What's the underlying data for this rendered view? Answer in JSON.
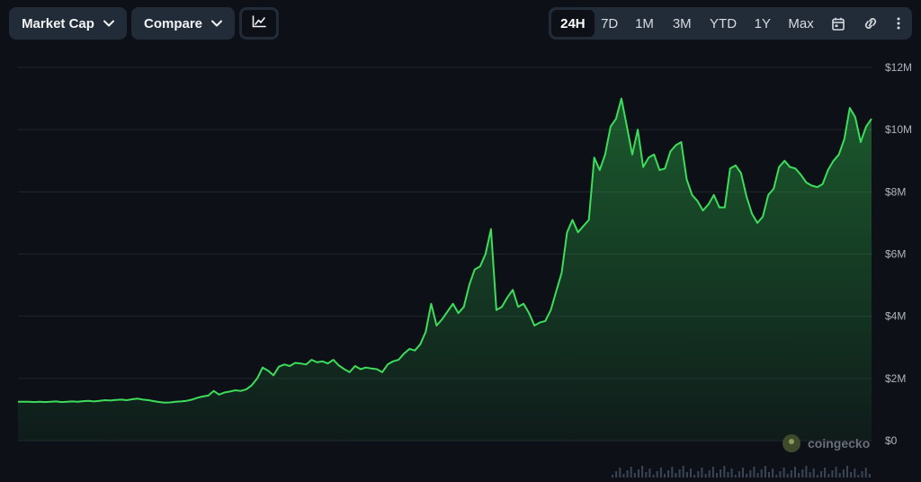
{
  "toolbar": {
    "market_cap_label": "Market Cap",
    "compare_label": "Compare",
    "chart_type_icon": "line-chart-icon",
    "ranges": [
      "24H",
      "7D",
      "1M",
      "3M",
      "YTD",
      "1Y",
      "Max"
    ],
    "active_range": "24H",
    "calendar_icon": "calendar-icon",
    "link_icon": "link-icon",
    "more_icon": "more-vertical-icon"
  },
  "watermark": {
    "text": "coingecko",
    "icon": "coingecko-logo-icon"
  },
  "colors": {
    "background": "#0d1117",
    "line": "#3ddc5a",
    "grid": "#1f252d",
    "control": "#222b38"
  },
  "chart_data": {
    "type": "area",
    "title": "",
    "xlabel": "",
    "ylabel": "",
    "y_tick_labels": [
      "$12M",
      "$10M",
      "$8M",
      "$6M",
      "$4M",
      "$2M",
      "$0"
    ],
    "y_ticks": [
      12,
      10,
      8,
      6,
      4,
      2,
      0
    ],
    "ylim": [
      0,
      12
    ],
    "unit": "$M",
    "grid": true,
    "series": [
      {
        "values": [
          1.25,
          1.25,
          1.25,
          1.24,
          1.25,
          1.24,
          1.25,
          1.26,
          1.24,
          1.25,
          1.26,
          1.25,
          1.27,
          1.28,
          1.26,
          1.28,
          1.3,
          1.29,
          1.31,
          1.32,
          1.3,
          1.33,
          1.35,
          1.32,
          1.3,
          1.27,
          1.24,
          1.22,
          1.23,
          1.25,
          1.26,
          1.28,
          1.32,
          1.38,
          1.42,
          1.45,
          1.6,
          1.48,
          1.55,
          1.58,
          1.62,
          1.6,
          1.65,
          1.78,
          2.0,
          2.35,
          2.25,
          2.1,
          2.38,
          2.45,
          2.4,
          2.5,
          2.48,
          2.45,
          2.6,
          2.52,
          2.55,
          2.48,
          2.6,
          2.42,
          2.3,
          2.2,
          2.4,
          2.3,
          2.35,
          2.32,
          2.3,
          2.2,
          2.45,
          2.55,
          2.6,
          2.8,
          2.95,
          2.9,
          3.1,
          3.5,
          4.4,
          3.7,
          3.9,
          4.15,
          4.4,
          4.1,
          4.3,
          5.0,
          5.5,
          5.6,
          6.0,
          6.8,
          4.2,
          4.3,
          4.6,
          4.85,
          4.3,
          4.4,
          4.1,
          3.7,
          3.8,
          3.85,
          4.2,
          4.8,
          5.4,
          6.7,
          7.1,
          6.7,
          6.9,
          7.1,
          9.1,
          8.7,
          9.2,
          10.1,
          10.35,
          11.0,
          10.1,
          9.2,
          10.0,
          8.8,
          9.1,
          9.2,
          8.7,
          8.75,
          9.3,
          9.5,
          9.6,
          8.4,
          7.9,
          7.7,
          7.4,
          7.6,
          7.9,
          7.5,
          7.5,
          8.75,
          8.85,
          8.6,
          7.85,
          7.3,
          7.0,
          7.2,
          7.9,
          8.1,
          8.8,
          9.0,
          8.8,
          8.75,
          8.55,
          8.3,
          8.2,
          8.15,
          8.25,
          8.7,
          9.0,
          9.2,
          9.7,
          10.7,
          10.4,
          9.6,
          10.1,
          10.35
        ]
      }
    ]
  }
}
